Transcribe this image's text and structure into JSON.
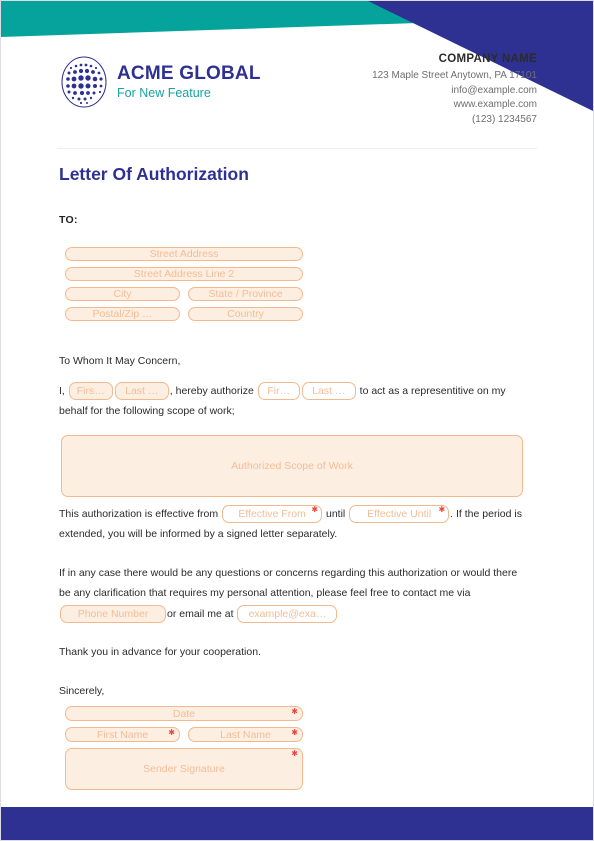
{
  "theme": {
    "teal": "#05a39b",
    "navy": "#2e3192",
    "field_border": "#f2b98f",
    "field_fill": "#fdeee2",
    "field_text": "#f3bd96",
    "required_red": "#e8453c",
    "body_text": "#2b2b2b"
  },
  "header": {
    "logo_name": "ACME GLOBAL",
    "logo_tagline": "For New Feature",
    "company_name": "COMPANY NAME",
    "address": "123 Maple Street Anytown, PA 17101",
    "email": "info@example.com",
    "website": "www.example.com",
    "phone": "(123) 1234567"
  },
  "document": {
    "title": "Letter Of Authorization",
    "to_label": "TO:"
  },
  "recipient_address": {
    "street": "Street Address",
    "street2": "Street Address Line 2",
    "city": "City",
    "state": "State / Province",
    "postal": "Postal/Zip …",
    "country": "Country"
  },
  "body": {
    "salutation": "To Whom It May Concern,",
    "authorize_prefix": "I,",
    "authorize_middle": ", hereby authorize",
    "authorize_suffix": "to act as a representitive on my behalf for the following scope of work;",
    "sender_first": "Firs…",
    "sender_last": "Last …",
    "agent_first": "Fir…",
    "agent_last": "Last …",
    "scope_placeholder": "Authorized Scope of Work",
    "effective_prefix": "This authorization is effective from",
    "effective_middle": "until",
    "effective_suffix": ". If the period is extended, you will be informed by a signed letter separately.",
    "effective_from": "Effective From",
    "effective_until": "Effective Until",
    "contact_text": "If in any case there would be any questions or concerns regarding this authorization or would there be any clarification that requires my personal attention, please feel free to contact me via",
    "contact_middle": "or email me at",
    "phone_placeholder": "Phone Number",
    "email_placeholder": "example@exa…",
    "thanks": "Thank you in advance for your cooperation.",
    "closing": "Sincerely,"
  },
  "signature": {
    "date": "Date",
    "first_name": "First Name",
    "last_name": "Last Name",
    "sender_signature": "Sender Signature",
    "required_marker": "✱"
  }
}
